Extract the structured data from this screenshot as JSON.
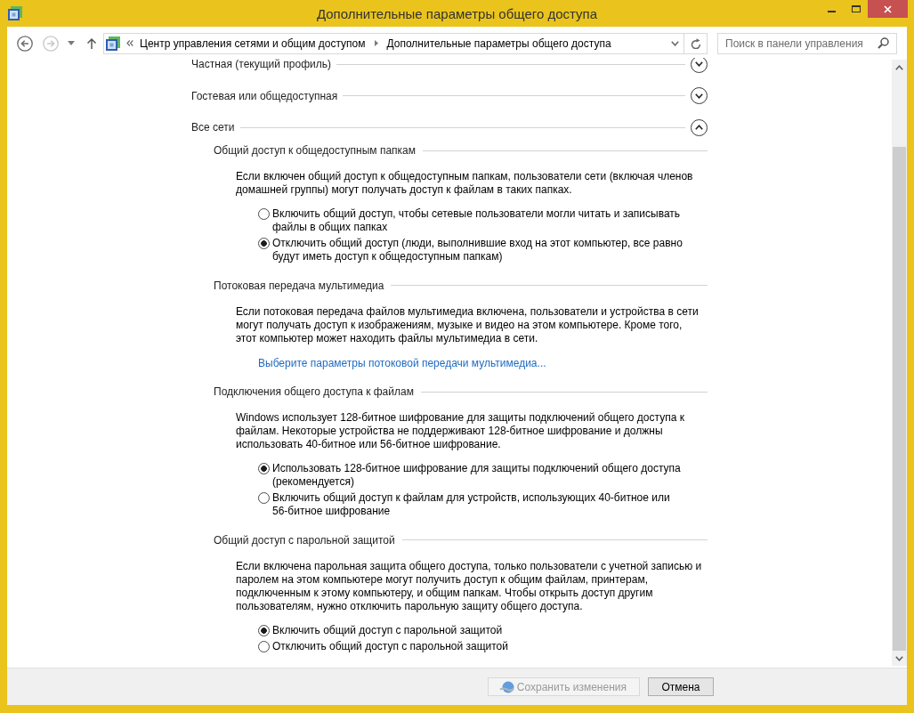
{
  "window": {
    "title": "Дополнительные параметры общего доступа"
  },
  "nav": {
    "back": {
      "disabled": false
    },
    "forward": {
      "disabled": true
    }
  },
  "address_bar": {
    "breadcrumbs": [
      "Центр управления сетями и общим доступом",
      "Дополнительные параметры общего доступа"
    ]
  },
  "search": {
    "placeholder": "Поиск в панели управления"
  },
  "profiles": [
    {
      "label": "Частная (текущий профиль)",
      "expanded": false
    },
    {
      "label": "Гостевая или общедоступная",
      "expanded": false
    },
    {
      "label": "Все сети",
      "expanded": true,
      "sections": [
        {
          "heading": "Общий доступ к общедоступным папкам",
          "description": "Если включен общий доступ к общедоступным папкам, пользователи сети (включая членов\nдомашней группы) могут получать доступ к файлам в таких папках.",
          "options": [
            {
              "label": "Включить общий доступ, чтобы сетевые пользователи могли читать и записывать\nфайлы в общих папках",
              "selected": false
            },
            {
              "label": "Отключить общий доступ (люди, выполнившие вход на этот компьютер, все равно\nбудут иметь доступ к общедоступным папкам)",
              "selected": true
            }
          ]
        },
        {
          "heading": "Потоковая передача мультимедиа",
          "description": "Если потоковая передача файлов мультимедиа включена, пользователи и устройства в сети\nмогут получать доступ к изображениям, музыке и видео на этом компьютере. Кроме того,\nэтот компьютер может находить файлы мультимедиа в сети.",
          "link": "Выберите параметры потоковой передачи мультимедиа..."
        },
        {
          "heading": "Подключения общего доступа к файлам",
          "description": "Windows использует 128-битное шифрование для защиты подключений общего доступа к\nфайлам. Некоторые устройства не поддерживают 128-битное шифрование и должны\nиспользовать 40-битное или 56-битное шифрование.",
          "options": [
            {
              "label": "Использовать 128-битное шифрование для защиты подключений общего доступа\n(рекомендуется)",
              "selected": true
            },
            {
              "label": "Включить общий доступ к файлам для устройств, использующих 40-битное или\n56-битное шифрование",
              "selected": false
            }
          ]
        },
        {
          "heading": "Общий доступ с парольной защитой",
          "description": "Если включена парольная защита общего доступа, только пользователи с учетной записью и\nпаролем на этом компьютере могут получить доступ к общим файлам, принтерам,\nподключенным к этому компьютеру, и общим папкам. Чтобы открыть доступ другим\nпользователям, нужно отключить парольную защиту общего доступа.",
          "options": [
            {
              "label": "Включить общий доступ с парольной защитой",
              "selected": true
            },
            {
              "label": "Отключить общий доступ с парольной защитой",
              "selected": false
            }
          ]
        }
      ]
    }
  ],
  "buttons": [
    {
      "label": "Сохранить изменения",
      "kind": "save",
      "disabled": true
    },
    {
      "label": "Отмена",
      "kind": "cancel",
      "disabled": false
    }
  ]
}
